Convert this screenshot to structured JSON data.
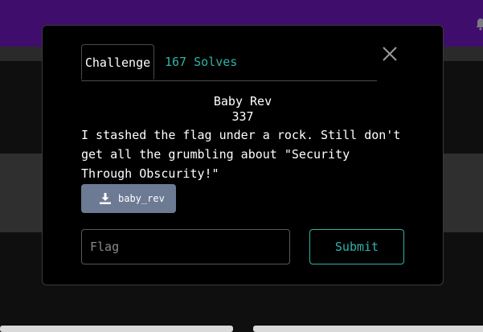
{
  "colors": {
    "topbar": "#3f0d6b",
    "accent": "#2fb3a7",
    "download_button": "#6c7a93",
    "modal_background": "#000000"
  },
  "header": {
    "icon": "bell-icon"
  },
  "modal": {
    "tabs": [
      {
        "label": "Challenge",
        "active": true
      },
      {
        "label": "167 Solves",
        "active": false
      }
    ],
    "close_icon": "close-icon",
    "challenge": {
      "name": "Baby Rev",
      "points": "337",
      "description": "I stashed the flag under a rock. Still don't get all the grumbling about \"Security Through Obscurity!\""
    },
    "file": {
      "icon": "download-icon",
      "label": "baby_rev"
    },
    "flag_input": {
      "placeholder": "Flag",
      "value": ""
    },
    "submit_label": "Submit"
  }
}
